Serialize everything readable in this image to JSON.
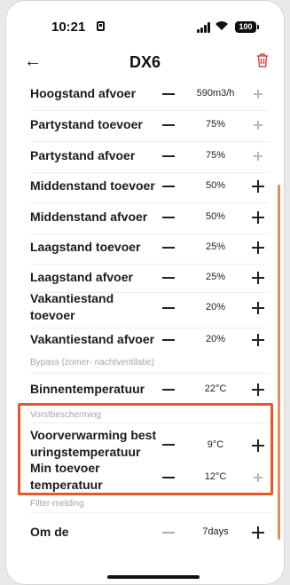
{
  "status": {
    "time": "10:21",
    "battery": "100"
  },
  "header": {
    "title": "DX6",
    "back_icon": "arrow-left-icon",
    "delete_icon": "trash-icon"
  },
  "colors": {
    "accent": "#e55a24",
    "delete": "#e0413a"
  },
  "rows": [
    {
      "label": "Hoogstand afvoer",
      "value": "590m3/h"
    },
    {
      "label": "Partystand toevoer",
      "value": "75%"
    },
    {
      "label": "Partystand afvoer",
      "value": "75%"
    },
    {
      "label": "Middenstand toevoer",
      "value": "50%"
    },
    {
      "label": "Middenstand afvoer",
      "value": "50%"
    },
    {
      "label": "Laagstand toevoer",
      "value": "25%"
    },
    {
      "label": "Laagstand afvoer",
      "value": "25%"
    },
    {
      "label1": "Vakantiestand",
      "label2": "toevoer",
      "value": "20%"
    },
    {
      "label": "Vakantiestand afvoer",
      "value": "20%"
    }
  ],
  "sections": {
    "bypass": "Bypass (zomer- nachtventilatie)",
    "vorst": "Vorstbescherming",
    "filter": "Filter-melding"
  },
  "bypass_rows": [
    {
      "label": "Binnentemperatuur",
      "value": "22°C"
    }
  ],
  "vorst_rows": [
    {
      "label1": "Voorverwarming best",
      "label2": "uringstemperatuur",
      "value": "9°C"
    },
    {
      "label1": "Min toevoer",
      "label2": "temperatuur",
      "value": "12°C"
    }
  ],
  "filter_rows": [
    {
      "label": "Om de",
      "value": "7days"
    }
  ]
}
